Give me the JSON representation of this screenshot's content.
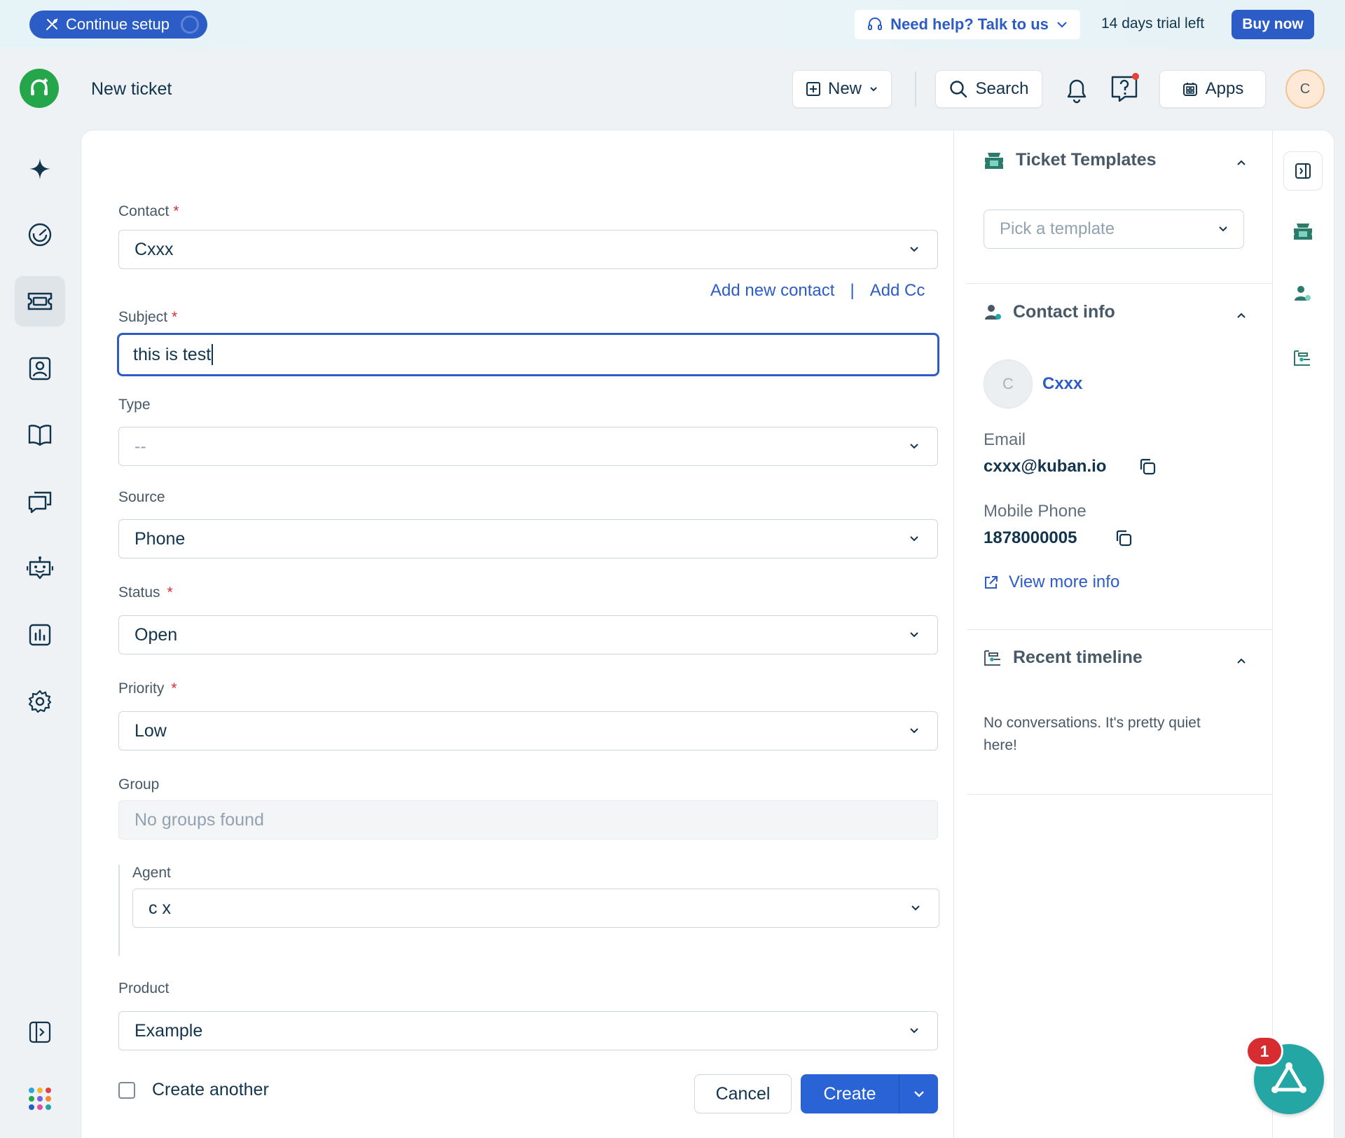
{
  "banner": {
    "continue_setup": "Continue setup",
    "help": "Need help? Talk to us",
    "trial": "14 days trial left",
    "buy_now": "Buy now"
  },
  "header": {
    "title": "New ticket",
    "new_label": "New",
    "search_label": "Search",
    "apps_label": "Apps",
    "avatar_initial": "C",
    "help_has_notification": true
  },
  "nav": {
    "items": [
      "freddy-ai-icon",
      "dashboard-icon",
      "tickets-icon",
      "contacts-icon",
      "solutions-icon",
      "conversations-icon",
      "bot-icon",
      "analytics-icon",
      "settings-icon"
    ],
    "active": "tickets-icon"
  },
  "form": {
    "contact": {
      "label": "Contact",
      "required": "*",
      "value": "Cxxx"
    },
    "add_new_contact": "Add new contact",
    "separator": "|",
    "add_cc": "Add Cc",
    "subject": {
      "label": "Subject",
      "required": "*",
      "value": "this is test"
    },
    "type": {
      "label": "Type",
      "value": "--"
    },
    "source": {
      "label": "Source",
      "value": "Phone"
    },
    "status": {
      "label": "Status",
      "required": "*",
      "value": "Open"
    },
    "priority": {
      "label": "Priority",
      "required": "*",
      "value": "Low"
    },
    "group": {
      "label": "Group",
      "value": "No groups found"
    },
    "agent": {
      "label": "Agent",
      "value": "c x"
    },
    "product": {
      "label": "Product",
      "value": "Example"
    },
    "create_another": "Create another",
    "cancel": "Cancel",
    "create": "Create"
  },
  "panel": {
    "templates": {
      "title": "Ticket Templates",
      "placeholder": "Pick a template"
    },
    "contact_info": {
      "title": "Contact info",
      "avatar_initial": "C",
      "name": "Cxxx",
      "email_label": "Email",
      "email": "cxxx@kuban.io",
      "phone_label": "Mobile Phone",
      "phone": "1878000005",
      "view_more": "View more info"
    },
    "timeline": {
      "title": "Recent timeline",
      "empty": "No conversations. It's pretty quiet here!"
    }
  },
  "bot": {
    "badge": "1"
  },
  "colors": {
    "primary": "#2c5cc5",
    "required": "#d72d30",
    "brand_green": "#25a64a",
    "bot_teal": "#24a6a4"
  }
}
